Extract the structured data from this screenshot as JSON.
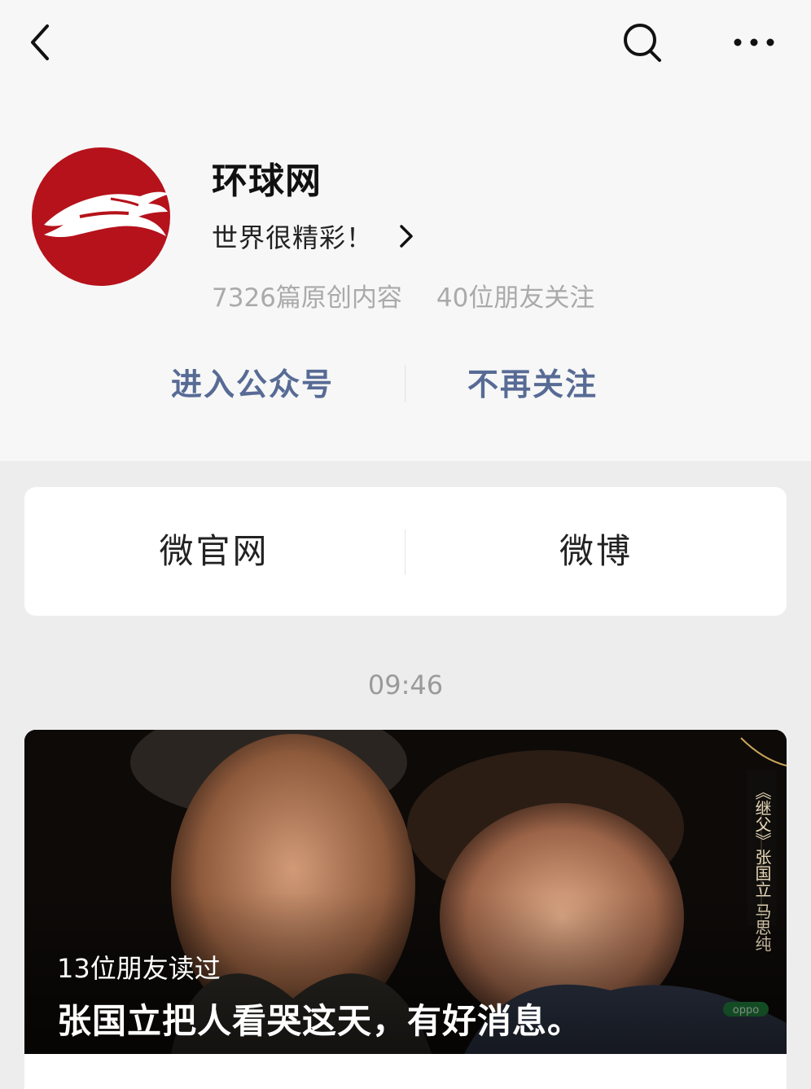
{
  "nav": {
    "back_icon": "chevron-left-icon",
    "search_icon": "search-icon",
    "more_icon": "more-dots-icon"
  },
  "profile": {
    "name": "环球网",
    "intro": "世界很精彩！",
    "original_count": "7326篇原创内容",
    "friends_following": "40位朋友关注",
    "avatar_color": "#b5121b"
  },
  "actions": {
    "enter_label": "进入公众号",
    "unfollow_label": "不再关注",
    "link_color": "#576b95"
  },
  "links": {
    "official_site_label": "微官网",
    "weibo_label": "微博"
  },
  "feed": {
    "time": "09:46",
    "article": {
      "read_by_friends": "13位朋友读过",
      "title": "张国立把人看哭这天，有好消息。",
      "cover_side_text": "《继父》张国立 马思纯",
      "cover_logo_text": "oppo"
    }
  }
}
